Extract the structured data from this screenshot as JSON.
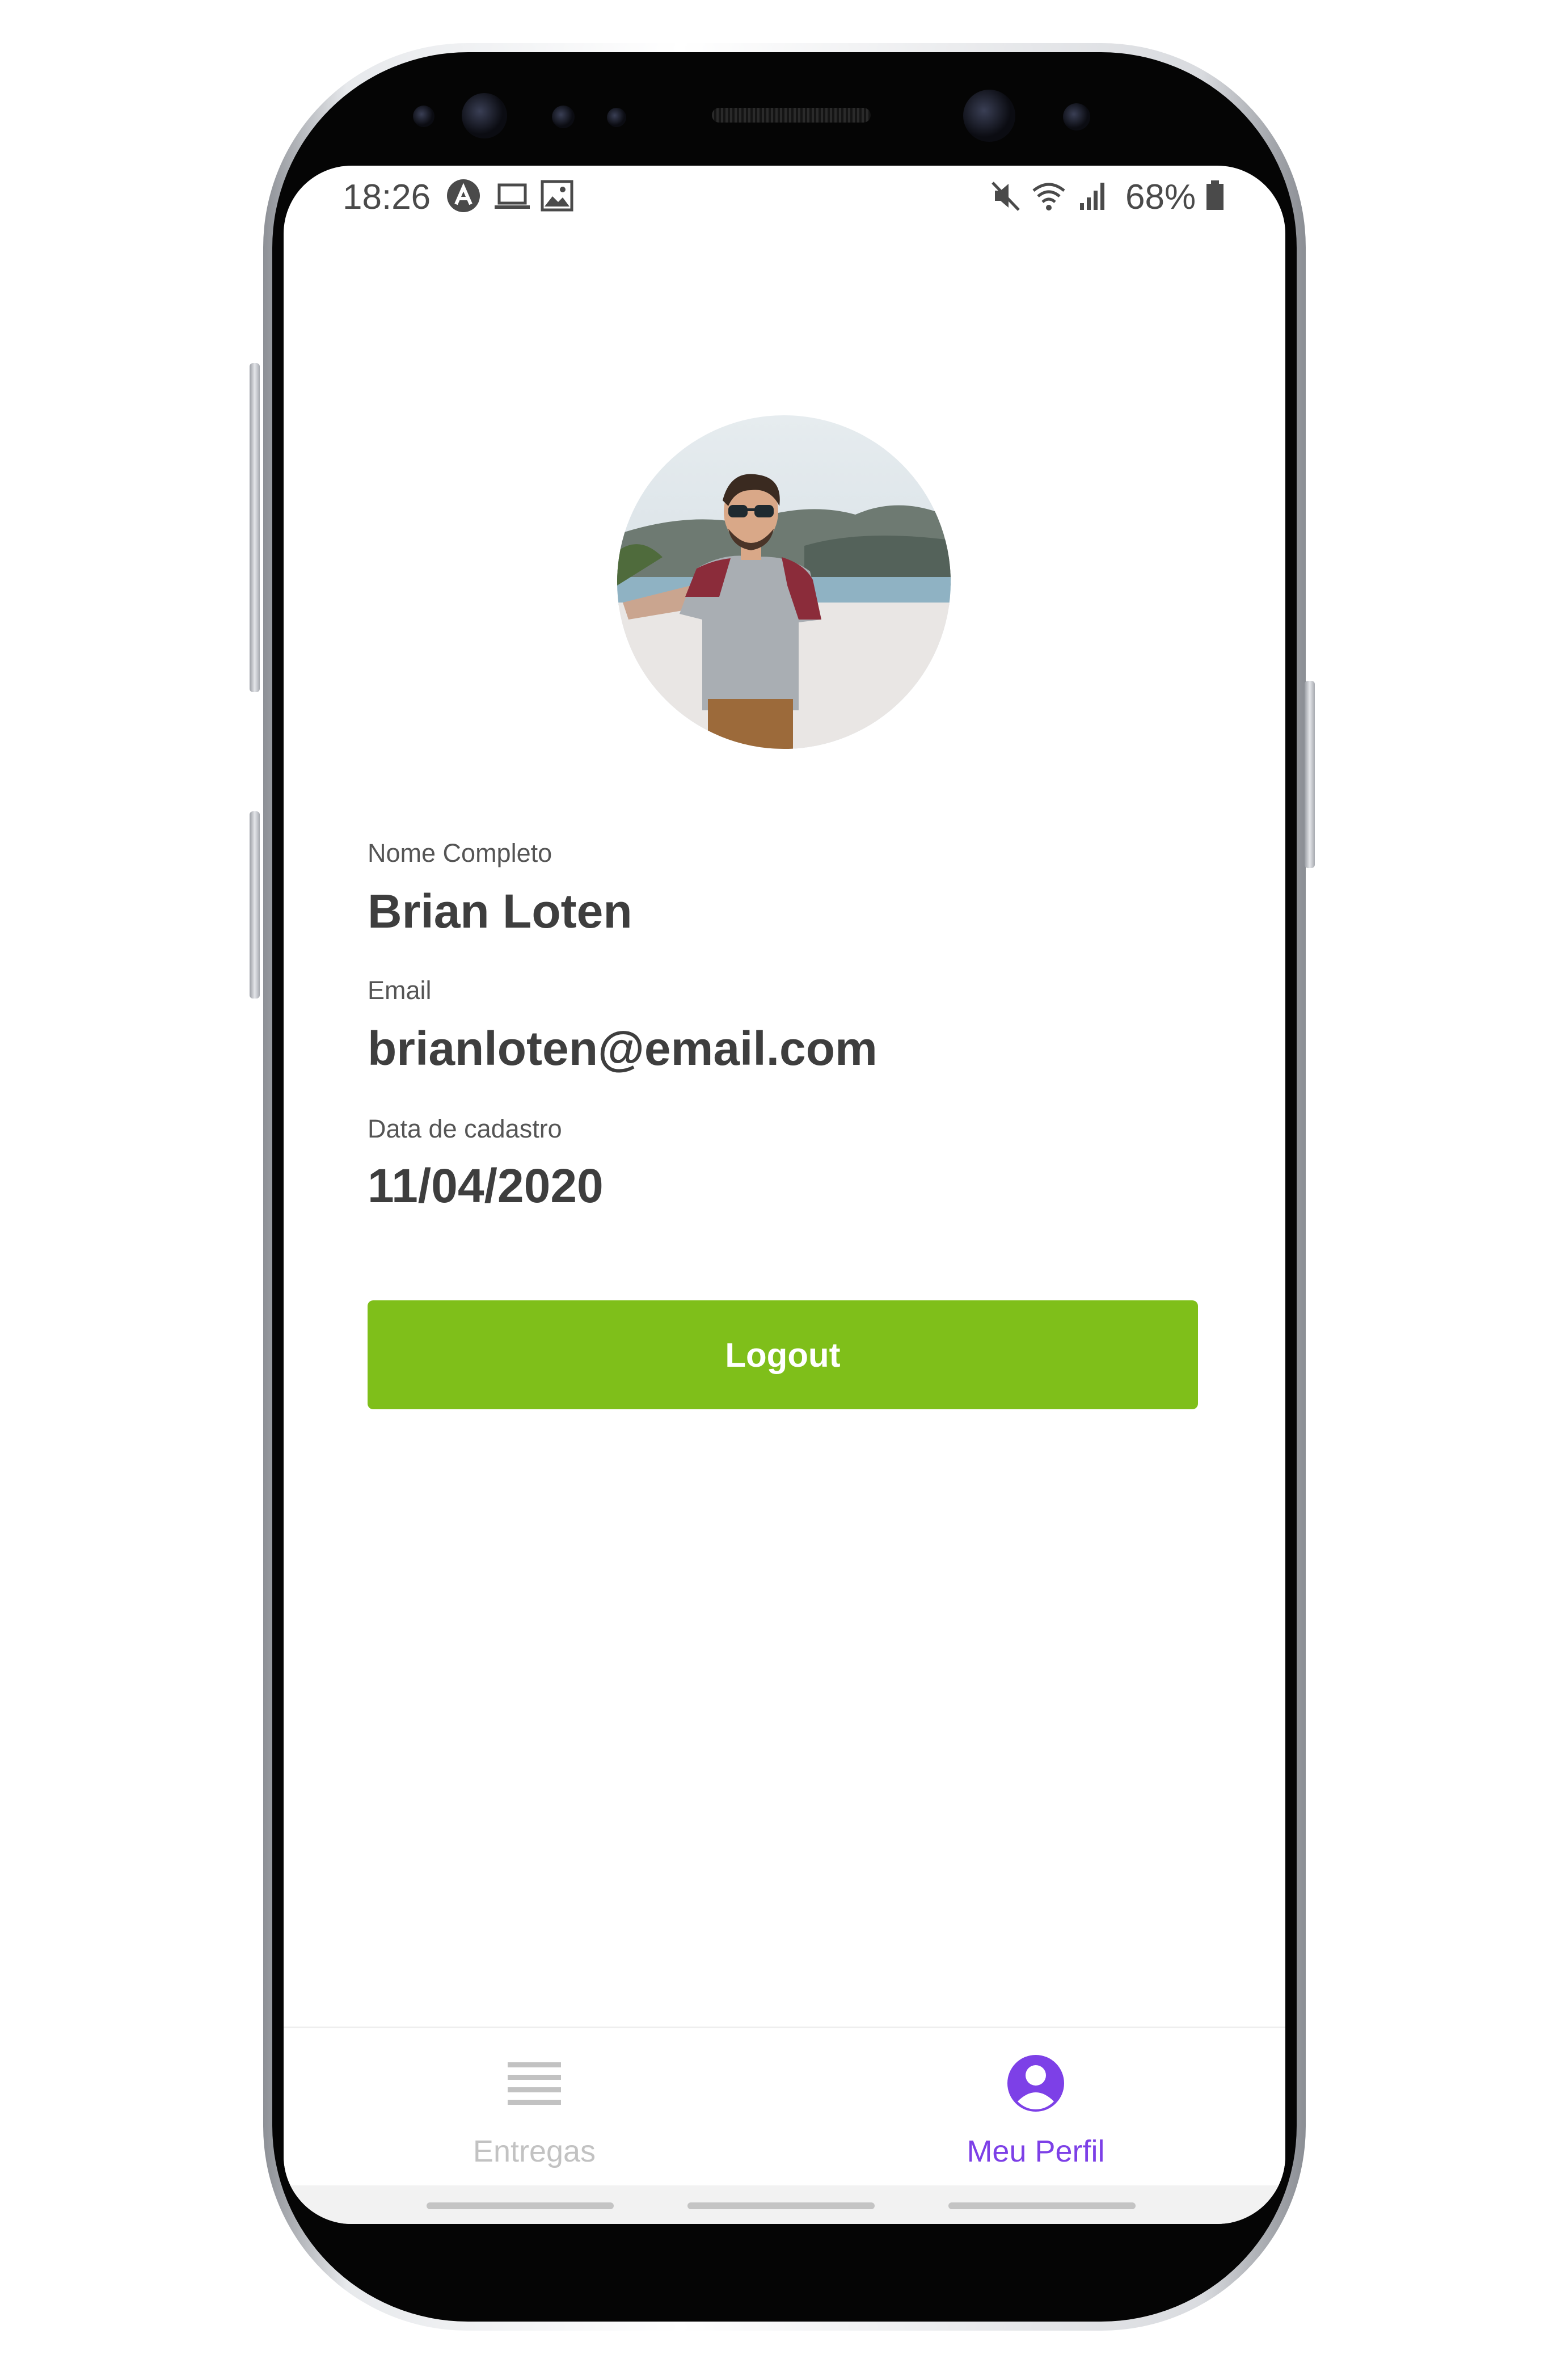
{
  "status_bar": {
    "time": "18:26",
    "battery": "68%",
    "icons": [
      "app-a-icon",
      "laptop-icon",
      "gallery-icon",
      "mute-icon",
      "wifi-icon",
      "signal-icon",
      "battery-icon"
    ]
  },
  "profile": {
    "avatar": "profile-photo",
    "fields": [
      {
        "label": "Nome Completo",
        "value": "Brian Loten"
      },
      {
        "label": "Email",
        "value": "brianloten@email.com"
      },
      {
        "label": "Data de cadastro",
        "value": "11/04/2020"
      }
    ]
  },
  "actions": {
    "logout_label": "Logout"
  },
  "tabs": [
    {
      "label": "Entregas",
      "icon": "list-icon",
      "active": false
    },
    {
      "label": "Meu Perfil",
      "icon": "user-circle-icon",
      "active": true
    }
  ],
  "colors": {
    "accent_purple": "#7d40e7",
    "logout_green": "#7fbf1a",
    "inactive_tab": "#c2c2c2",
    "text_dark": "#3e3e3e"
  }
}
